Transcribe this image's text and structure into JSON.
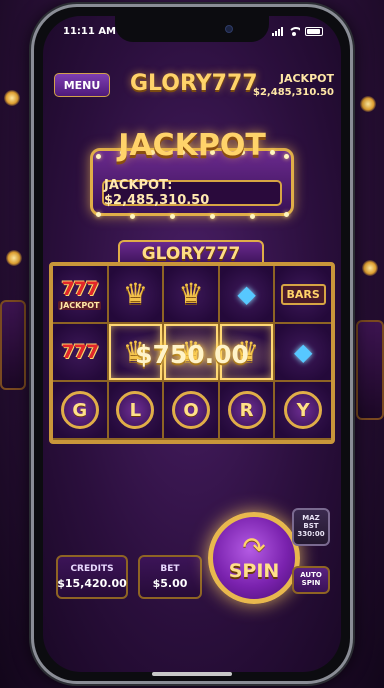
{
  "status_bar": {
    "time": "11:11 AM"
  },
  "header": {
    "menu_label": "MENU",
    "brand": "GLORY777",
    "jackpot_label": "JACKPOT",
    "jackpot_value": "$2,485,310.50"
  },
  "jackpot_banner": {
    "title": "JACKPOT",
    "value_text": "JACKPOT: $2,485,310.50"
  },
  "reels": {
    "title": "GLORY777",
    "rows": [
      [
        {
          "symbol": "777",
          "label": "JACKPOT"
        },
        {
          "symbol": "crown"
        },
        {
          "symbol": "crown"
        },
        {
          "symbol": "diamond"
        },
        {
          "symbol": "BARS"
        }
      ],
      [
        {
          "symbol": "777"
        },
        {
          "symbol": "crown"
        },
        {
          "symbol": "crown"
        },
        {
          "symbol": "crown"
        },
        {
          "symbol": "diamond"
        }
      ],
      [
        {
          "symbol": "G"
        },
        {
          "symbol": "L"
        },
        {
          "symbol": "O"
        },
        {
          "symbol": "R"
        },
        {
          "symbol": "Y"
        }
      ]
    ],
    "win_amount": "$750.00"
  },
  "controls": {
    "credits_label": "CREDITS",
    "credits_value": "$15,420.00",
    "bet_label": "BET",
    "bet_value": "$5.00",
    "spin_label": "SPIN",
    "max_bet_line1": "MAZ",
    "max_bet_line2": "BST",
    "max_bet_line3": "330:00",
    "auto_spin_line1": "AUTO",
    "auto_spin_line2": "SPIN"
  },
  "colors": {
    "accent_gold": "#e0ae48",
    "bg_purple": "#2b0f3d",
    "spin_purple": "#7a22ae"
  }
}
